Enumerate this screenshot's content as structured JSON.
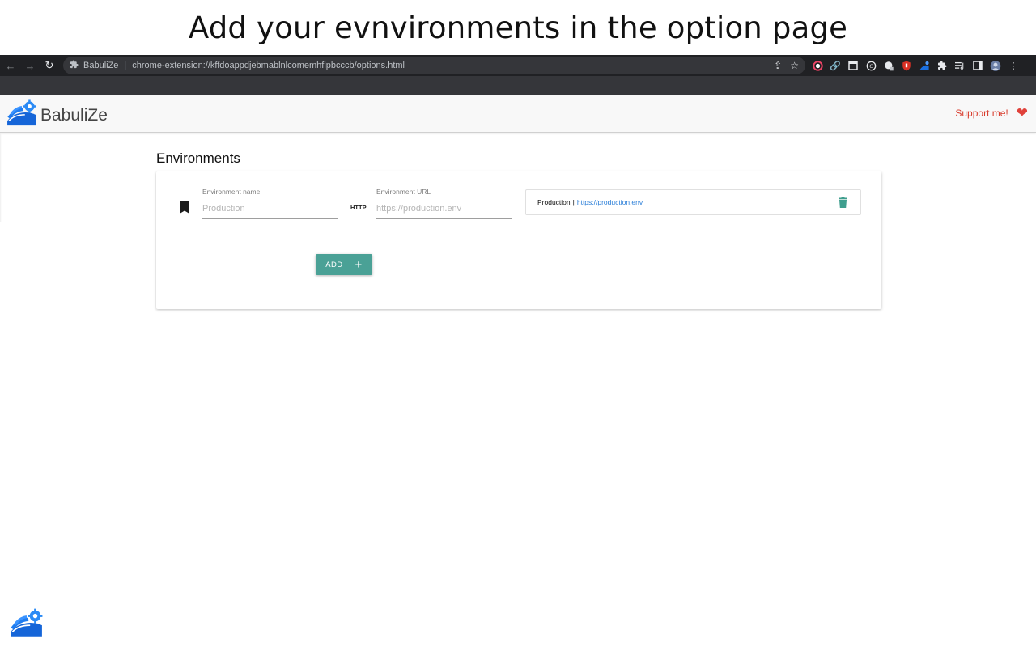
{
  "caption": "Add your evnvironments in the option page",
  "browser": {
    "site_name": "BabuliZe",
    "url": "chrome-extension://kffdoappdjebmablnlcomemhflpbcccb/options.html",
    "extension_icons": [
      "color-picker-icon",
      "link-icon",
      "window-icon",
      "c-icon",
      "ghost-icon",
      "shield-icon",
      "babulize-icon",
      "puzzle-icon",
      "playlist-icon",
      "sidebar-icon",
      "avatar-icon",
      "more-icon"
    ]
  },
  "app": {
    "brand_name": "BabuliZe",
    "support_label": "Support me!",
    "accent_color": "#4aa196",
    "support_color": "#d83a2a"
  },
  "environments": {
    "title": "Environments",
    "name_field": {
      "label": "Environment name",
      "placeholder": "Production",
      "value": ""
    },
    "protocol_label": "HTTP",
    "url_field": {
      "label": "Environment URL",
      "placeholder": "https://production.env",
      "value": ""
    },
    "add_button_label": "ADD",
    "items": [
      {
        "name": "Production",
        "separator": "|",
        "url": "https://production.env"
      }
    ]
  }
}
